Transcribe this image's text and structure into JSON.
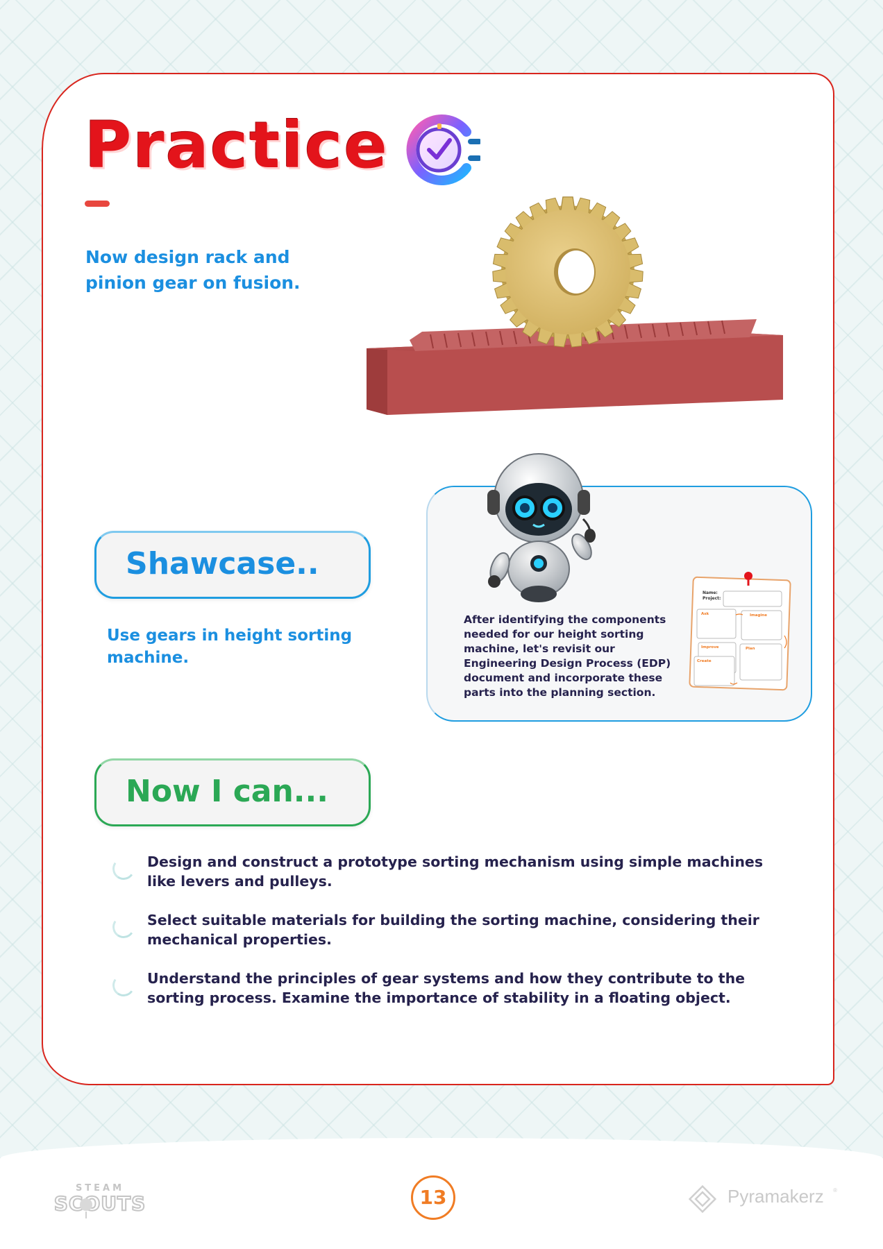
{
  "page": {
    "title": "Practice",
    "intro": "Now design rack and pinion gear on fusion.",
    "showcase": {
      "heading": "Shawcase..",
      "text": "Use gears in height sorting machine.",
      "info": "After identifying the components needed for our height sorting machine, let's revisit our Engineering Design Process (EDP) document and incorporate these parts into the planning section.",
      "edp_labels": {
        "name": "Name:",
        "project": "Project:",
        "ask": "Ask",
        "imagine": "Imagine",
        "improve": "Improve",
        "plan": "Plan",
        "create": "Create"
      }
    },
    "now_i_can": {
      "heading": "Now I can...",
      "items": [
        "Design and construct a prototype sorting mechanism using simple machines like levers and pulleys.",
        "Select suitable materials for building the sorting machine, considering their mechanical properties.",
        "Understand the principles of gear systems and how they contribute to the sorting process. Examine the importance of stability in a floating object."
      ]
    }
  },
  "footer": {
    "steam_top": "STEAM",
    "steam_bottom": "SCOUTS",
    "page_number": "13",
    "brand": "Pyramakerz",
    "brand_mark": "®"
  },
  "colors": {
    "title_red": "#e3141b",
    "blue": "#1b8fe0",
    "green": "#2ba855",
    "navy_text": "#26224d",
    "page_number_orange": "#f07c24",
    "card_border": "#d9251d"
  },
  "icons": [
    "clock-check-icon",
    "circle-bullet-icon",
    "pyramakerz-logo-icon",
    "steam-scouts-logo"
  ]
}
